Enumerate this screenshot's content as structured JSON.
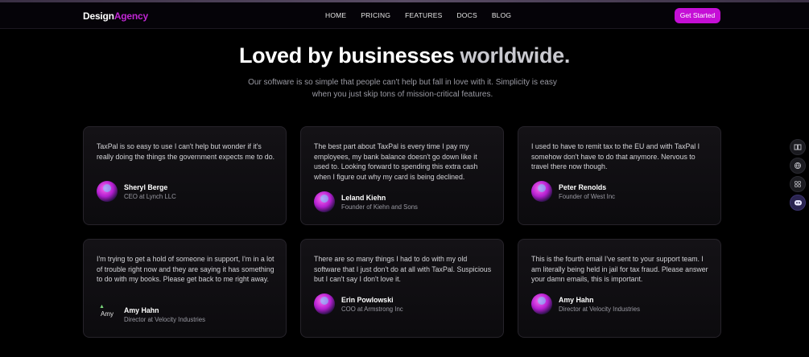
{
  "nav": {
    "logo_primary": "Design",
    "logo_accent": "Agency",
    "items": [
      "HOME",
      "PRICING",
      "FEATURES",
      "DOCS",
      "BLOG"
    ],
    "cta_label": "Get Started"
  },
  "hero": {
    "title_part1": "Loved by businesses",
    "title_part2": "worldwide.",
    "subtitle": "Our software is so simple that people can't help but fall in love with it. Simplicity is easy when you just skip tons of mission-critical features."
  },
  "testimonials": [
    {
      "quote": "TaxPal is so easy to use I can't help but wonder if it's really doing the things the government expects me to do.",
      "name": "Sheryl Berge",
      "role": "CEO at Lynch LLC"
    },
    {
      "quote": "The best part about TaxPal is every time I pay my employees, my bank balance doesn't go down like it used to. Looking forward to spending this extra cash when I figure out why my card is being declined.",
      "name": "Leland Kiehn",
      "role": "Founder of Kiehn and Sons"
    },
    {
      "quote": "I used to have to remit tax to the EU and with TaxPal I somehow don't have to do that anymore. Nervous to travel there now though.",
      "name": "Peter Renolds",
      "role": "Founder of West Inc"
    },
    {
      "quote": "I'm trying to get a hold of someone in support, I'm in a lot of trouble right now and they are saying it has something to do with my books. Please get back to me right away.",
      "name": "Amy Hahn",
      "role": "Director at Velocity Industries",
      "avatar_alt": "Amy"
    },
    {
      "quote": "There are so many things I had to do with my old software that I just don't do at all with TaxPal. Suspicious but I can't say I don't love it.",
      "name": "Erin Powlowski",
      "role": "COO at Armstrong Inc"
    },
    {
      "quote": "This is the fourth email I've sent to your support team. I am literally being held in jail for tax fraud. Please answer your damn emails, this is important.",
      "name": "Amy Hahn",
      "role": "Director at Velocity Industries"
    }
  ],
  "colors": {
    "accent": "#c50fd6",
    "background": "#000000"
  }
}
